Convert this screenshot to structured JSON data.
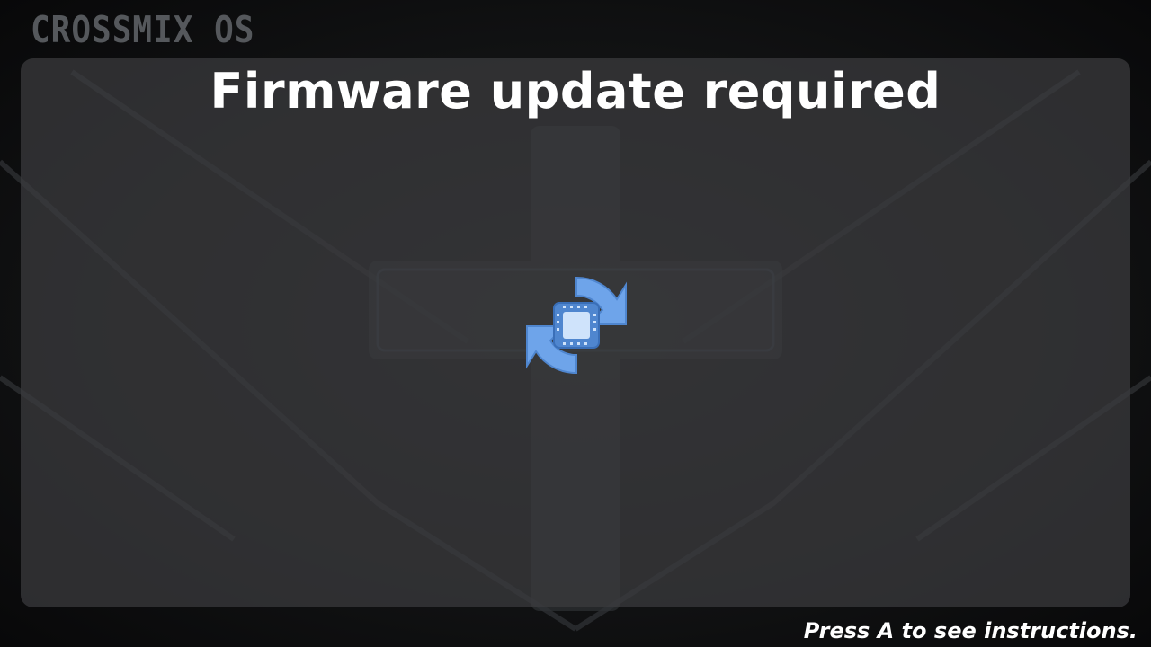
{
  "brand": {
    "logo_text": "CROSSMIX OS"
  },
  "dialog": {
    "title": "Firmware update required",
    "icon": "firmware-update-icon"
  },
  "footer": {
    "hint": "Press A to see instructions."
  },
  "colors": {
    "panel": "#3c3c3e",
    "title_text": "#ffffff",
    "icon_blue": "#6ea4ea",
    "icon_chip": "#cfe3fb"
  }
}
